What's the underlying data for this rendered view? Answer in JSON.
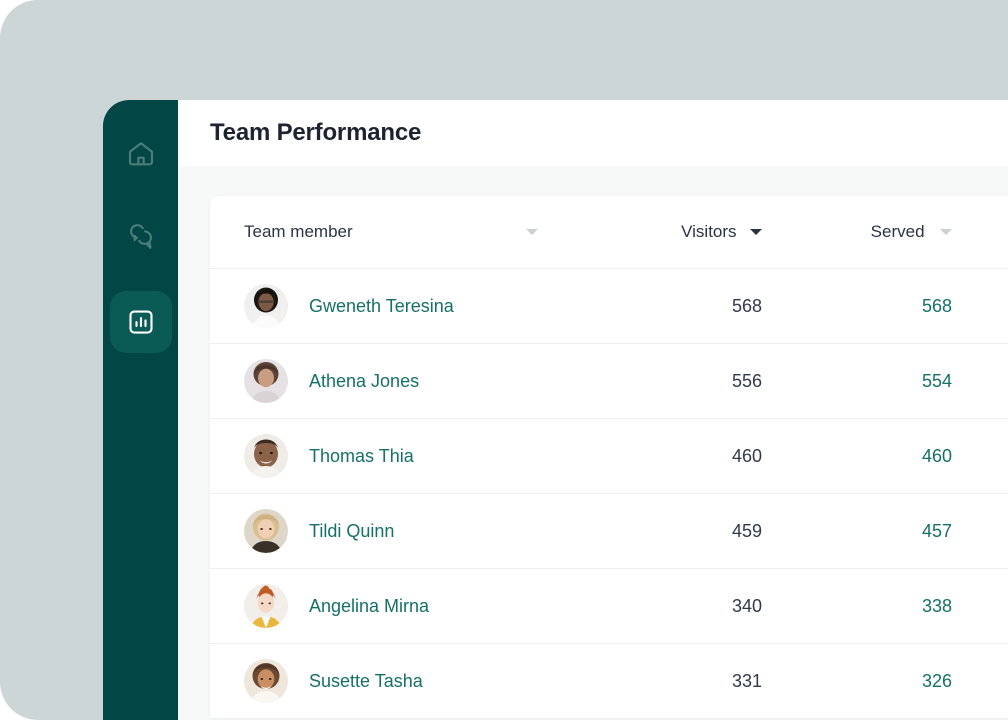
{
  "app": {
    "title": "Team Performance",
    "accent_teal": "#147068",
    "sidebar_bg": "#024745",
    "sidebar_active_bg": "#0a5a56",
    "backdrop": "#ccd6d7",
    "content_bg": "#f7f8f8",
    "card_bg": "#ffffff",
    "row_divider": "#eceef0",
    "value_color": "#31394a"
  },
  "sidebar": {
    "items": [
      {
        "icon": "home-icon",
        "label": "Home",
        "active": false
      },
      {
        "icon": "chat-icon",
        "label": "Messages",
        "active": false
      },
      {
        "icon": "chart-icon",
        "label": "Analytics",
        "active": true
      }
    ]
  },
  "table": {
    "columns": [
      {
        "key": "member",
        "label": "Team member",
        "sort_icon": "chevron-down-icon",
        "sorted": false
      },
      {
        "key": "visitors",
        "label": "Visitors",
        "sort_icon": "chevron-down-icon",
        "sorted": true
      },
      {
        "key": "served",
        "label": "Served",
        "sort_icon": "chevron-down-icon",
        "sorted": false
      }
    ],
    "rows": [
      {
        "name": "Gweneth Teresina",
        "visitors": "568",
        "served": "568",
        "avatar": "avatar-gweneth"
      },
      {
        "name": "Athena Jones",
        "visitors": "556",
        "served": "554",
        "avatar": "avatar-athena"
      },
      {
        "name": "Thomas Thia",
        "visitors": "460",
        "served": "460",
        "avatar": "avatar-thomas"
      },
      {
        "name": "Tildi Quinn",
        "visitors": "459",
        "served": "457",
        "avatar": "avatar-tildi"
      },
      {
        "name": "Angelina Mirna",
        "visitors": "340",
        "served": "338",
        "avatar": "avatar-angelina"
      },
      {
        "name": "Susette Tasha",
        "visitors": "331",
        "served": "326",
        "avatar": "avatar-susette"
      }
    ]
  }
}
